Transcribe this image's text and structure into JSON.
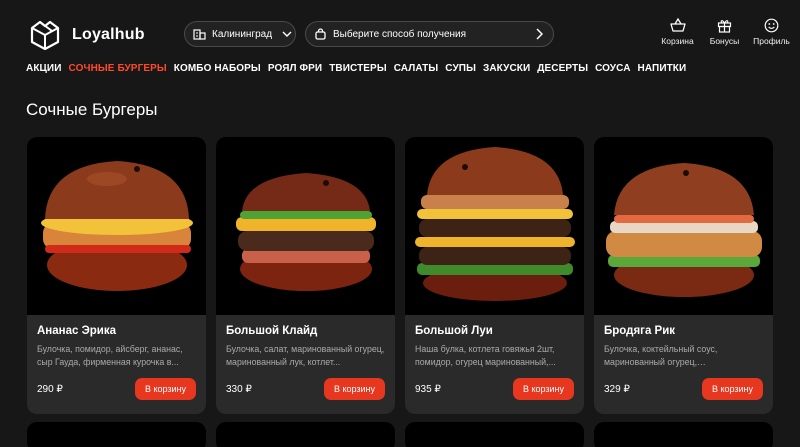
{
  "brand": {
    "name": "Loyalhub"
  },
  "header": {
    "city": "Калининград",
    "delivery_placeholder": "Выберите способ получения",
    "icons": [
      {
        "label": "Корзина",
        "icon": "basket-icon"
      },
      {
        "label": "Бонусы",
        "icon": "gift-icon"
      },
      {
        "label": "Профиль",
        "icon": "smile-icon"
      }
    ]
  },
  "nav": [
    {
      "label": "АКЦИИ",
      "active": false
    },
    {
      "label": "СОЧНЫЕ БУРГЕРЫ",
      "active": true
    },
    {
      "label": "КОМБО НАБОРЫ",
      "active": false
    },
    {
      "label": "РОЯЛ ФРИ",
      "active": false
    },
    {
      "label": "ТВИСТЕРЫ",
      "active": false
    },
    {
      "label": "САЛАТЫ",
      "active": false
    },
    {
      "label": "СУПЫ",
      "active": false
    },
    {
      "label": "ЗАКУСКИ",
      "active": false
    },
    {
      "label": "ДЕСЕРТЫ",
      "active": false
    },
    {
      "label": "СОУСА",
      "active": false
    },
    {
      "label": "НАПИТКИ",
      "active": false
    }
  ],
  "section_title": "Сочные Бургеры",
  "products": [
    {
      "name": "Ананас Эрика",
      "description": "Булочка, помидор, айсберг, ананас, сыр Гауда, фирменная курочка в...",
      "price": "290 ₽",
      "button": "В корзину"
    },
    {
      "name": "Большой Клайд",
      "description": "Булочка, салат, маринованный огурец, маринованный лук, котлет...",
      "price": "330 ₽",
      "button": "В корзину"
    },
    {
      "name": "Большой Луи",
      "description": "Наша булка, котлета говяжья 2шт, помидор, огурец маринованный,...",
      "price": "935 ₽",
      "button": "В корзину"
    },
    {
      "name": "Бродяга Рик",
      "description": "Булочка, коктейльный соус, маринованный огурец, маринованный...",
      "price": "329 ₽",
      "button": "В корзину"
    }
  ],
  "colors": {
    "accent": "#ff4a2a",
    "button": "#e8371f",
    "card": "#2a2a2a",
    "background": "#171717"
  }
}
